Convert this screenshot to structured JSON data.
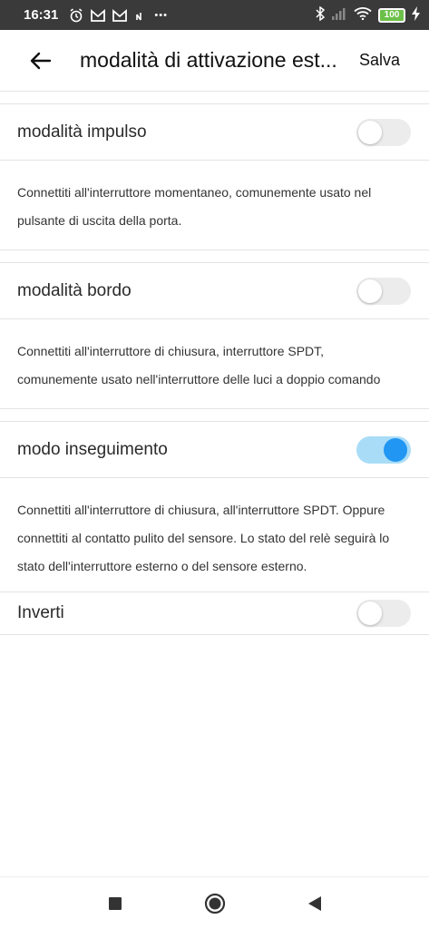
{
  "status_bar": {
    "time": "16:31",
    "left_icons": [
      "alarm-icon",
      "mail-icon",
      "mail-icon",
      "nfc-icon",
      "more-dots-icon"
    ],
    "more": "•••",
    "battery": "100"
  },
  "header": {
    "title": "modalità di attivazione est...",
    "save_label": "Salva"
  },
  "settings": [
    {
      "label": "modalità impulso",
      "enabled": false,
      "description": "Connettiti all'interruttore momentaneo, comunemente usato nel pulsante di uscita della porta."
    },
    {
      "label": "modalità bordo",
      "enabled": false,
      "description": "Connettiti all'interruttore di chiusura, interruttore SPDT, comunemente usato nell'interruttore delle luci a doppio comando"
    },
    {
      "label": "modo inseguimento",
      "enabled": true,
      "description": "Connettiti all'interruttore di chiusura, all'interruttore SPDT. Oppure connettiti al contatto pulito del sensore. Lo stato del relè seguirà lo stato dell'interruttore esterno o del sensore esterno."
    }
  ],
  "invert": {
    "label": "Inverti",
    "enabled": false
  },
  "colors": {
    "accent": "#2196f3",
    "toggle_on_track": "#a9dcf7",
    "toggle_off_track": "#ececec",
    "status_bar_bg": "#3a3a3a"
  }
}
